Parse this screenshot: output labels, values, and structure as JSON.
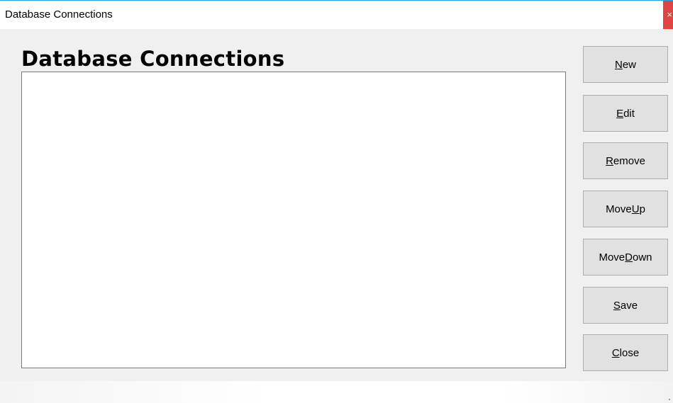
{
  "window": {
    "title": "Database Connections",
    "close_glyph": "×"
  },
  "main": {
    "heading": "Database Connections",
    "connections": []
  },
  "buttons": [
    {
      "pre": "",
      "acc": "N",
      "post": "ew"
    },
    {
      "pre": "",
      "acc": "E",
      "post": "dit"
    },
    {
      "pre": "",
      "acc": "R",
      "post": "emove"
    },
    {
      "pre": "Move ",
      "acc": "U",
      "post": "p"
    },
    {
      "pre": "Move ",
      "acc": "D",
      "post": "own"
    },
    {
      "pre": "",
      "acc": "S",
      "post": "ave"
    },
    {
      "pre": "",
      "acc": "C",
      "post": "lose"
    }
  ]
}
